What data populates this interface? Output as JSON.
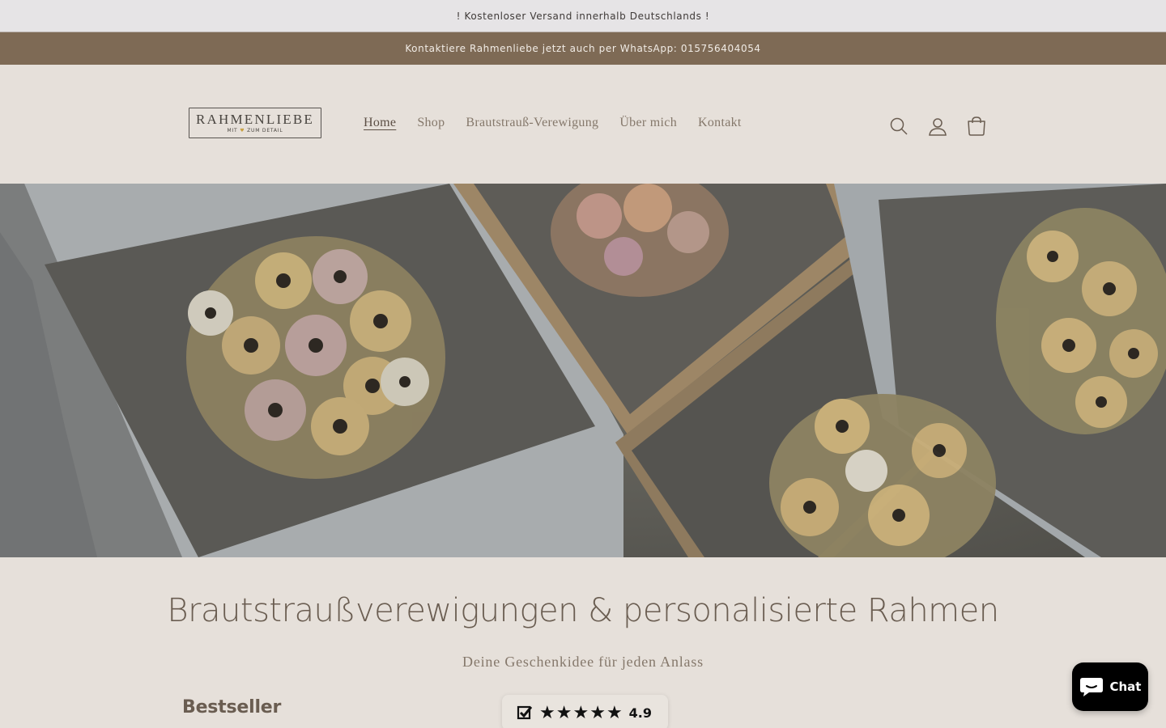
{
  "announcement_bar": {
    "text": "! Kostenloser Versand innerhalb Deutschlands !"
  },
  "contact_bar": {
    "text": "Kontaktiere Rahmenliebe jetzt auch per WhatsApp: 015756404054"
  },
  "header": {
    "logo": {
      "main": "RAHMENLIEBE",
      "sub_left": "MIT",
      "sub_right": "ZUM DETAIL"
    },
    "nav": [
      {
        "label": "Home",
        "active": true
      },
      {
        "label": "Shop",
        "active": false
      },
      {
        "label": "Brautstrauß-Verewigung",
        "active": false
      },
      {
        "label": "Über mich",
        "active": false
      },
      {
        "label": "Kontakt",
        "active": false
      }
    ],
    "icons": [
      "search-icon",
      "account-icon",
      "cart-icon"
    ]
  },
  "hero": {
    "image": "pressed-bridal-bouquet-frames"
  },
  "main": {
    "heading": "Brautstraußverewigungen & personalisierte Rahmen",
    "subheading": "Deine Geschenkidee für jeden Anlass",
    "section_title": "Bestseller"
  },
  "rating_badge": {
    "score": "4.9",
    "stars": 5
  },
  "chat_button": {
    "label": "Chat"
  },
  "colors": {
    "accent_brown": "#7e6a55",
    "background": "#e6e0da",
    "text": "#6a5d51"
  }
}
